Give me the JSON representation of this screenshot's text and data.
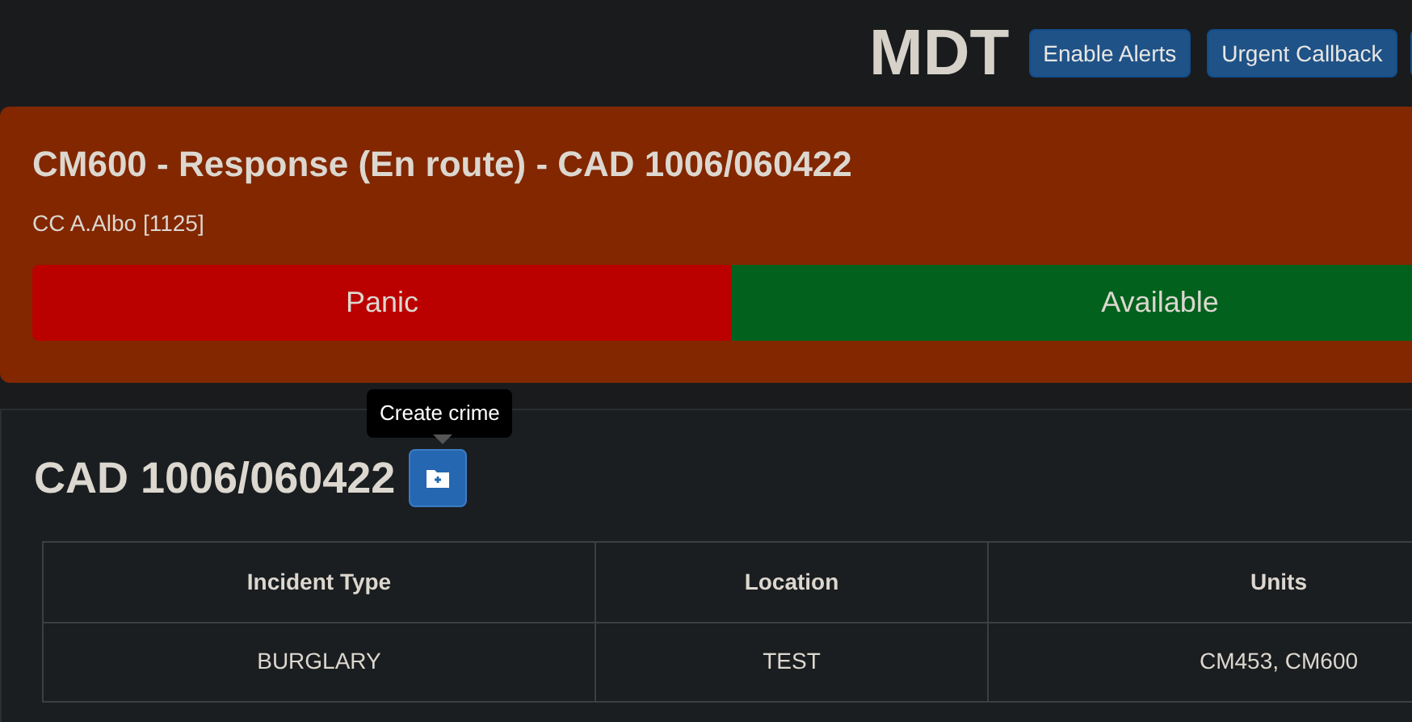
{
  "header": {
    "title": "MDT",
    "buttons": [
      "Enable Alerts",
      "Urgent Callback"
    ]
  },
  "unit_status": {
    "title": "CM600 - Response (En route) - CAD 1006/060422",
    "officer": "CC A.Albo [1125]",
    "actions": [
      {
        "label": "Panic",
        "kind": "danger"
      },
      {
        "label": "Available",
        "kind": "success"
      }
    ]
  },
  "incident": {
    "title": "CAD 1006/060422",
    "tooltip": "Create crime",
    "table": {
      "columns": [
        "Incident Type",
        "Location",
        "Units"
      ],
      "rows": [
        [
          "BURGLARY",
          "TEST",
          "CM453, CM600"
        ]
      ]
    }
  }
}
